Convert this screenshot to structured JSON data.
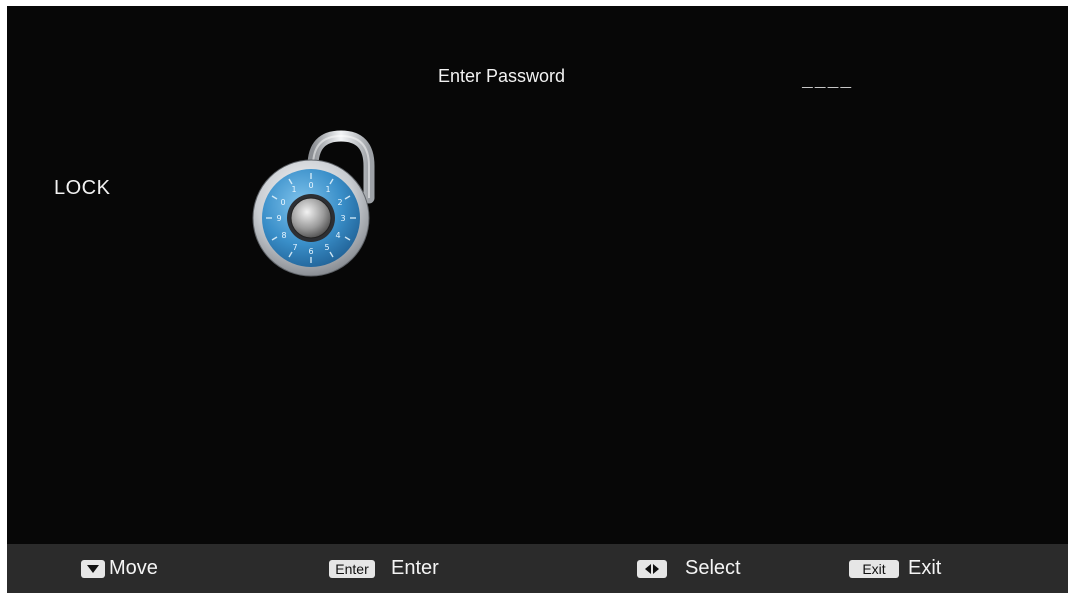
{
  "screen": {
    "section_label": "LOCK",
    "password": {
      "title": "Enter Password",
      "value": "____"
    },
    "lock_icon": "combination-padlock-icon"
  },
  "footer": {
    "move": {
      "icon": "down-arrow-icon",
      "label": "Move"
    },
    "enter": {
      "key": "Enter",
      "label": "Enter"
    },
    "select": {
      "icon": "left-right-arrows-icon",
      "label": "Select"
    },
    "exit": {
      "key": "Exit",
      "label": "Exit"
    }
  },
  "colors": {
    "background": "#070707",
    "footer_bar": "#2b2b2b",
    "lock_dial": "#3a8fc9",
    "text": "#f2f2f2"
  }
}
